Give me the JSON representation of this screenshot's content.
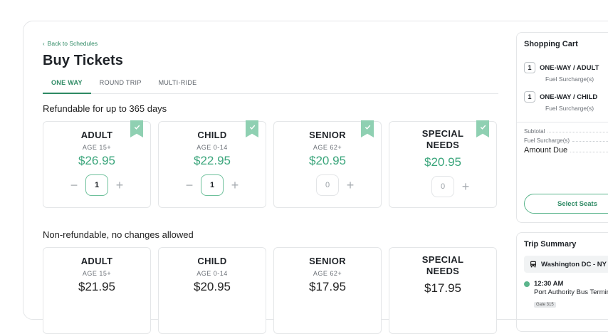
{
  "header": {
    "back_label": "Back to Schedules",
    "title": "Buy Tickets"
  },
  "tabs": [
    {
      "label": "ONE WAY",
      "active": true
    },
    {
      "label": "ROUND TRIP",
      "active": false
    },
    {
      "label": "MULTI-RIDE",
      "active": false
    }
  ],
  "refundable": {
    "title": "Refundable for up to 365 days",
    "cards": [
      {
        "name": "ADULT",
        "age": "AGE 15+",
        "price": "$26.95",
        "qty": "1",
        "selected": true
      },
      {
        "name": "CHILD",
        "age": "AGE 0-14",
        "price": "$22.95",
        "qty": "1",
        "selected": true
      },
      {
        "name": "SENIOR",
        "age": "AGE 62+",
        "price": "$20.95",
        "qty": "0",
        "selected": true
      },
      {
        "name_line1": "SPECIAL",
        "name_line2": "NEEDS",
        "price": "$20.95",
        "qty": "0",
        "selected": true
      }
    ]
  },
  "nonrefundable": {
    "title": "Non-refundable, no changes allowed",
    "cards": [
      {
        "name": "ADULT",
        "age": "AGE 15+",
        "price": "$21.95"
      },
      {
        "name": "CHILD",
        "age": "AGE 0-14",
        "price": "$20.95"
      },
      {
        "name": "SENIOR",
        "age": "AGE 62+",
        "price": "$17.95"
      },
      {
        "name_line1": "SPECIAL",
        "name_line2": "NEEDS",
        "price": "$17.95"
      }
    ]
  },
  "cart": {
    "title": "Shopping Cart",
    "items": [
      {
        "qty": "1",
        "label": "ONE-WAY / ADULT",
        "meta": "Fuel Surcharge(s)"
      },
      {
        "qty": "1",
        "label": "ONE-WAY / CHILD",
        "meta": "Fuel Surcharge(s)"
      }
    ],
    "subtotal_label": "Subtotal",
    "fuel_label": "Fuel Surcharge(s)",
    "amount_label": "Amount Due",
    "select_seats": "Select Seats"
  },
  "trip": {
    "title": "Trip Summary",
    "route": "Washington DC - NY",
    "stop_time": "12:30 AM",
    "stop_place": "Port Authority Bus Terminal",
    "stop_gate": "Gate 315"
  },
  "colors": {
    "accent": "#2e8a64",
    "price_green": "#3aa57b",
    "ribbon": "#8fd0b2"
  }
}
